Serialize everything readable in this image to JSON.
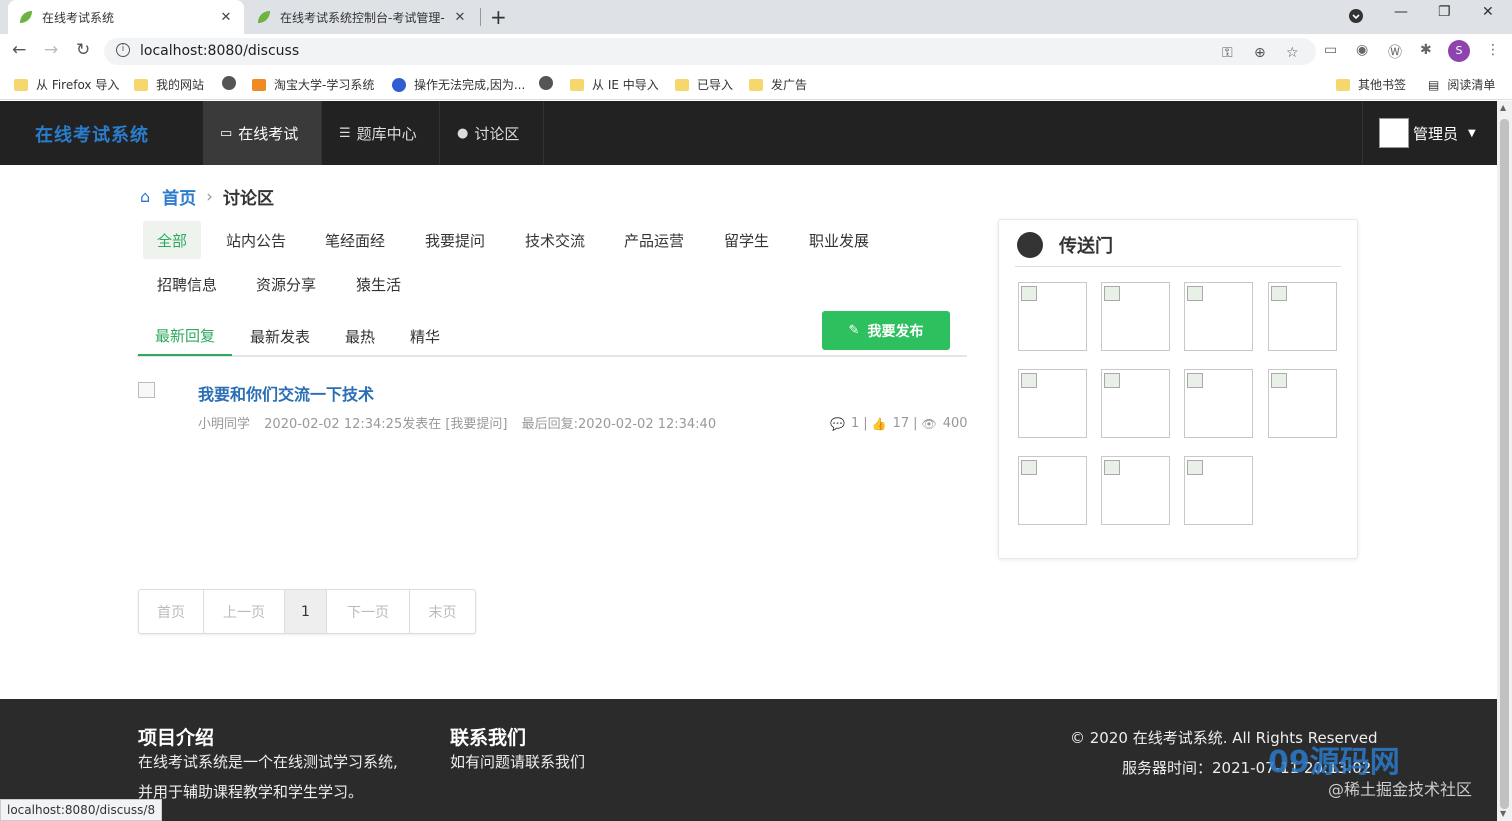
{
  "browser": {
    "tabs": [
      {
        "title": "在线考试系统",
        "active": true
      },
      {
        "title": "在线考试系统控制台-考试管理-"
      }
    ],
    "new_tab": "+",
    "url": "localhost:8080/discuss",
    "bookmarks": [
      "从 Firefox 导入",
      "我的网站",
      "淘宝大学-学习系统",
      "操作无法完成,因为...",
      "从 IE 中导入",
      "已导入",
      "发广告"
    ],
    "bookmarks_right": [
      "其他书签",
      "阅读清单"
    ],
    "profile_initial": "S",
    "status_url": "localhost:8080/discuss/8"
  },
  "navbar": {
    "brand": "在线考试系统",
    "items": [
      "在线考试",
      "题库中心",
      "讨论区"
    ],
    "active_index": 0,
    "user": "管理员"
  },
  "breadcrumb": {
    "home": "首页",
    "current": "讨论区"
  },
  "categories": [
    "全部",
    "站内公告",
    "笔经面经",
    "我要提问",
    "技术交流",
    "产品运营",
    "留学生",
    "职业发展",
    "招聘信息",
    "资源分享",
    "猿生活"
  ],
  "sort_tabs": [
    "最新回复",
    "最新发表",
    "最热",
    "精华"
  ],
  "post_button": "我要发布",
  "posts": [
    {
      "title": "我要和你们交流一下技术",
      "author": "小明同学",
      "posted": "2020-02-02 12:34:25发表在 [我要提问]",
      "last_reply": "最后回复:2020-02-02 12:34:40",
      "comments": "1",
      "likes": "17",
      "views": "400"
    }
  ],
  "pagination": [
    "首页",
    "上一页",
    "1",
    "下一页",
    "末页"
  ],
  "portal": {
    "title": "传送门",
    "tile_count": 11
  },
  "footer": {
    "intro_title": "项目介绍",
    "intro_line1": "在线考试系统是一个在线测试学习系统,",
    "intro_line2": "并用于辅助课程教学和学生学习。",
    "contact_title": "联系我们",
    "contact_text": "如有问题请联系我们",
    "copyright": "© 2020 在线考试系统. All Rights Reserved",
    "server_time": "服务器时间：2021-07-11 20:13:02"
  },
  "watermark": {
    "main": "09源码网",
    "sub": "@稀土掘金技术社区"
  },
  "colors": {
    "accent": "#2eaa5e",
    "link": "#2a6fb5",
    "brand": "#2a7ccc",
    "navbar": "#222222",
    "footer": "#2b2b2b"
  }
}
